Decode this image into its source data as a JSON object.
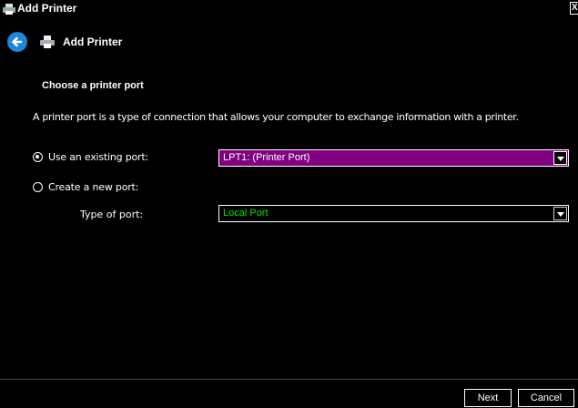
{
  "window": {
    "title": "Add Printer",
    "close_glyph": "X",
    "icons": {
      "app": "printer-icon",
      "close": "close-icon"
    }
  },
  "wizard": {
    "back_icon": "back-arrow-icon",
    "header_icon": "printer-icon",
    "header_title": "Add Printer"
  },
  "content": {
    "heading": "Choose a printer port",
    "description": "A printer port is a type of connection that allows your computer to exchange information with a printer.",
    "options": [
      {
        "label": "Use an existing port:",
        "selected": true
      },
      {
        "label": "Create a new port:",
        "selected": false
      }
    ],
    "existing_port": {
      "value": "LPT1: (Printer Port)"
    },
    "port_type": {
      "label": "Type of port:",
      "value": "Local Port"
    }
  },
  "buttons": {
    "next": "Next",
    "cancel": "Cancel"
  },
  "colors": {
    "background": "#000000",
    "text": "#ffffff",
    "selected_combo_bg": "#800080",
    "port_type_text": "#00e400",
    "back_button": "#1f86d8"
  }
}
